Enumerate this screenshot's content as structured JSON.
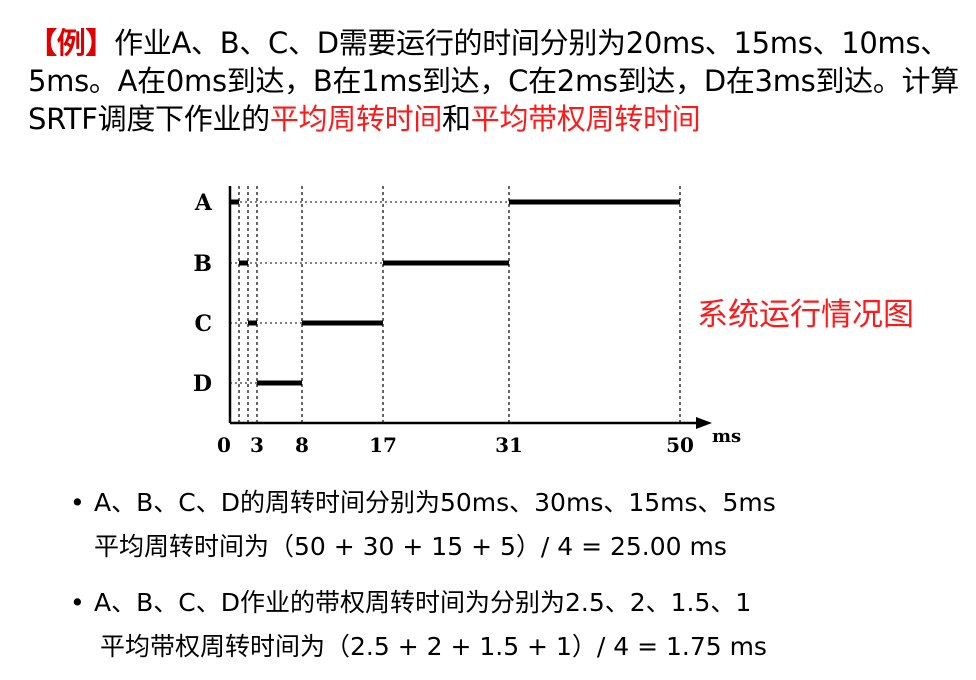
{
  "problem": {
    "prefix": "【例】",
    "text1": "作业A、B、C、D需要运行的时间分别为20ms、15ms、10ms、5ms。A在0ms到达，B在1ms到达，C在2ms到达，D在3ms到达。计算SRTF调度下作业的",
    "highlight1": "平均周转时间",
    "conj": "和",
    "highlight2": "平均带权周转时间"
  },
  "caption": "系统运行情况图",
  "gantt": {
    "jobs": [
      "A",
      "B",
      "C",
      "D"
    ],
    "unit": "ms",
    "ticks": [
      0,
      3,
      8,
      17,
      31,
      50
    ],
    "markers": [
      0,
      1,
      2,
      3,
      8,
      17,
      31,
      50
    ],
    "segments": [
      {
        "job": "A",
        "start": 0,
        "end": 1
      },
      {
        "job": "B",
        "start": 1,
        "end": 2
      },
      {
        "job": "C",
        "start": 2,
        "end": 3
      },
      {
        "job": "D",
        "start": 3,
        "end": 8
      },
      {
        "job": "C",
        "start": 8,
        "end": 17
      },
      {
        "job": "B",
        "start": 17,
        "end": 31
      },
      {
        "job": "A",
        "start": 31,
        "end": 50
      }
    ]
  },
  "bullets": [
    {
      "bullet": "•",
      "line": "A、B、C、D的周转时间分别为50ms、30ms、15ms、5ms",
      "sub": "平均周转时间为（50 + 30 + 15 + 5）/ 4 = 25.00 ms"
    },
    {
      "bullet": "•",
      "line": "A、B、C、D作业的带权周转时间为分别为2.5、2、1.5、1",
      "sub": "平均带权周转时间为（2.5 + 2 + 1.5 + 1）/ 4 = 1.75 ms"
    }
  ]
}
